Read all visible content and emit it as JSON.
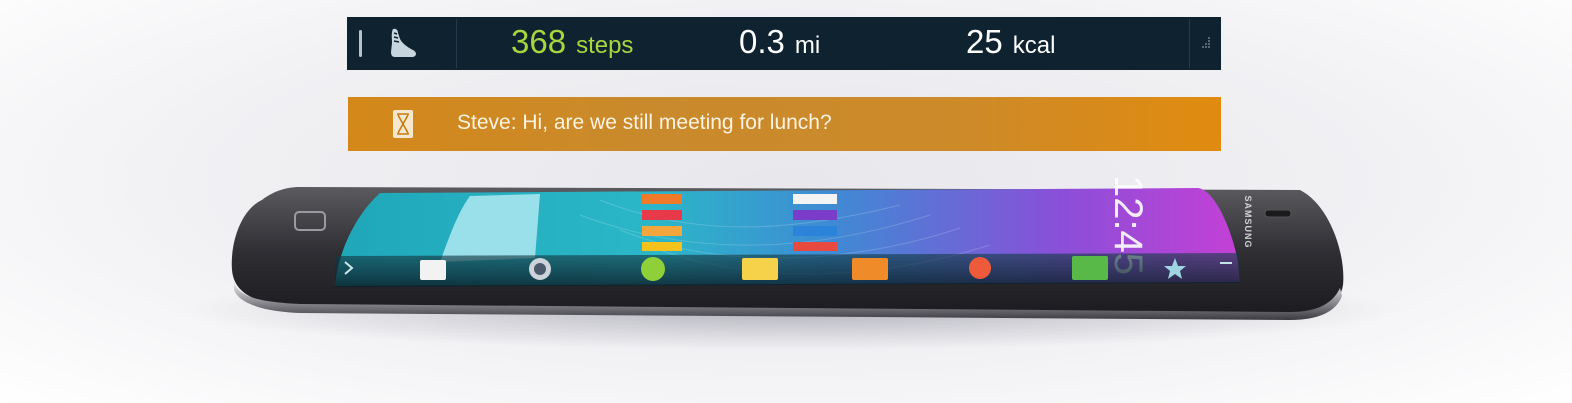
{
  "fitness_bar": {
    "steps_value": "368",
    "steps_unit": "steps",
    "distance_value": "0.3",
    "distance_unit": "mi",
    "calories_value": "25",
    "calories_unit": "kcal",
    "icon": "shoe-icon",
    "steps_color": "#a8d63e",
    "background": "#0e2230"
  },
  "notification": {
    "message": "Steve: Hi, are we still meeting for lunch?",
    "icon": "message-icon",
    "background": "#d48819"
  },
  "phone": {
    "brand": "SAMSUNG",
    "clock": "12:45",
    "edge_apps": [
      "play-store-icon",
      "camera-icon",
      "gallery-icon",
      "email-icon",
      "contacts-icon",
      "music-icon",
      "phone-icon"
    ]
  }
}
